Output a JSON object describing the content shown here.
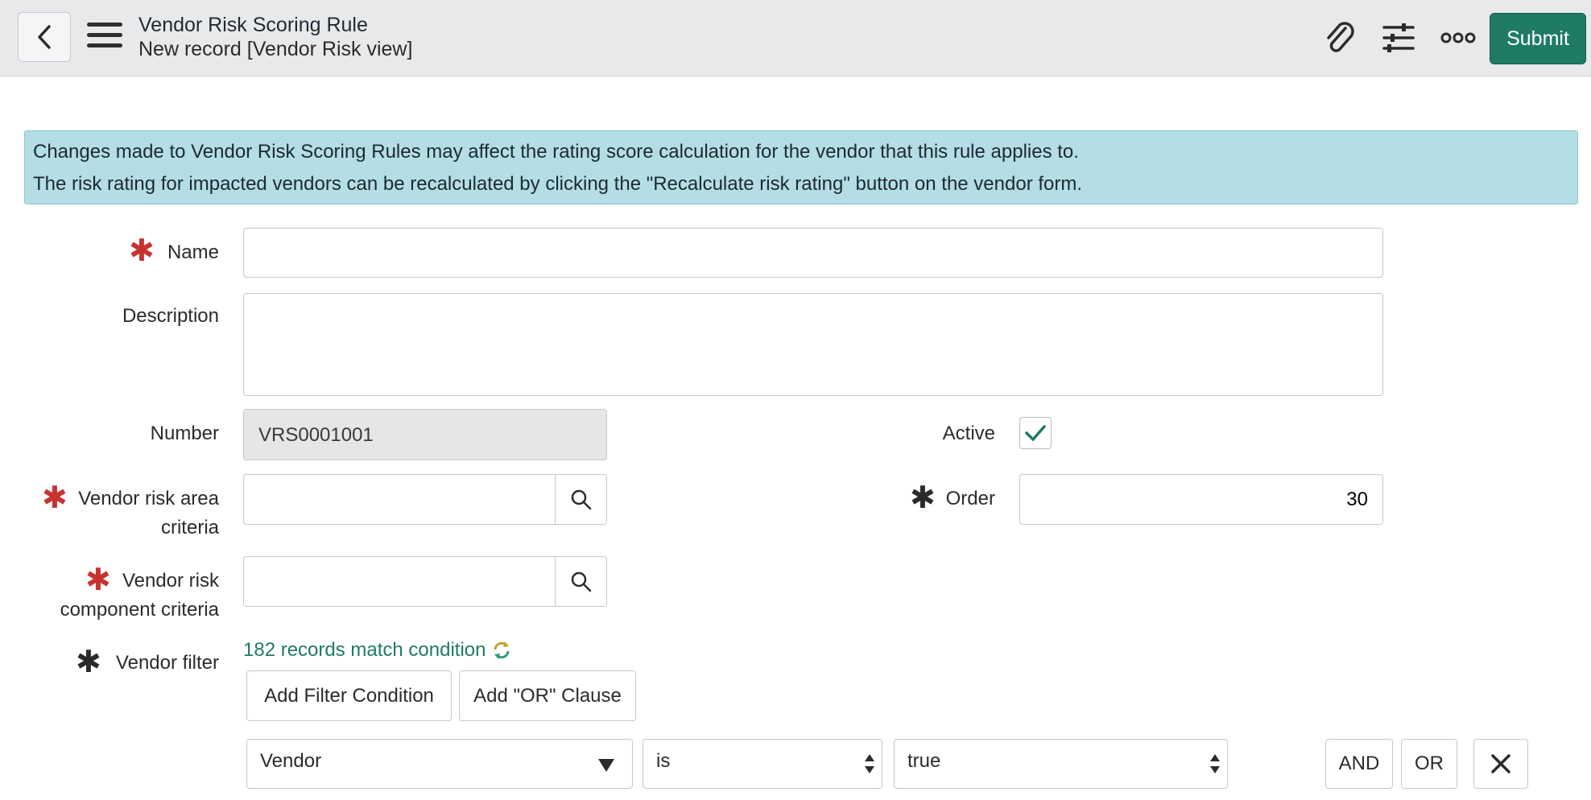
{
  "header": {
    "title": "Vendor Risk Scoring Rule",
    "subtitle": "New record [Vendor Risk view]",
    "submit_label": "Submit",
    "icons": [
      "back-icon",
      "menu-icon",
      "paperclip-icon",
      "settings-sliders-icon",
      "more-icon"
    ]
  },
  "banner": {
    "line1": "Changes made to Vendor Risk Scoring Rules may affect the rating score calculation for the vendor that this rule applies to.",
    "line2": "The risk rating for impacted vendors can be recalculated by clicking the \"Recalculate risk rating\" button on the vendor form."
  },
  "form": {
    "name_label": "Name",
    "name_value": "",
    "description_label": "Description",
    "description_value": "",
    "number_label": "Number",
    "number_value": "VRS0001001",
    "active_label": "Active",
    "active_checked": true,
    "risk_area_label": "Vendor risk area criteria",
    "risk_area_value": "",
    "order_label": "Order",
    "order_value": "30",
    "risk_component_label": "Vendor risk component criteria",
    "risk_component_value": "",
    "filter_label": "Vendor filter",
    "records_match": "182 records match condition",
    "add_filter_label": "Add Filter Condition",
    "add_or_label": "Add \"OR\" Clause",
    "condition": {
      "field": "Vendor",
      "operator": "is",
      "value": "true"
    },
    "and_label": "AND",
    "or_label": "OR"
  },
  "colors": {
    "accent": "#1f7a66",
    "required": "#c8322f",
    "banner_bg": "#b4dde4"
  }
}
